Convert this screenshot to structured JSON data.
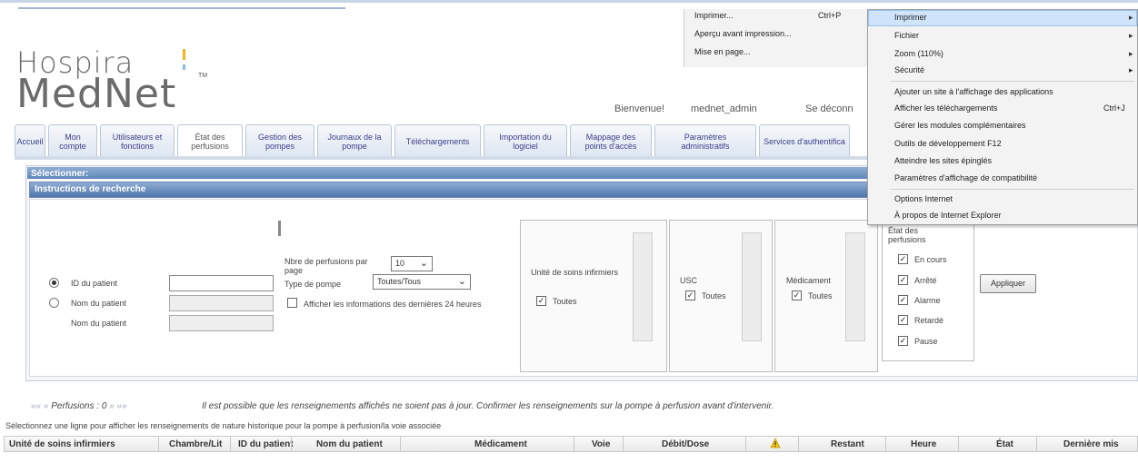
{
  "logo": {
    "line1": "Hospira",
    "line2": "MedNet",
    "tm": "TM"
  },
  "header": {
    "welcome": "Bienvenue!",
    "username": "mednet_admin",
    "logout": "Se déconn"
  },
  "nav": {
    "tabs": [
      {
        "label": "Accueil"
      },
      {
        "label": "Mon compte"
      },
      {
        "label": "Utilisateurs et fonctions"
      },
      {
        "label": "État des perfusions"
      },
      {
        "label": "Gestion des pompes"
      },
      {
        "label": "Journaux de la pompe"
      },
      {
        "label": "Téléchargements"
      },
      {
        "label": "Importation du logiciel"
      },
      {
        "label": "Mappage des points d'accès"
      },
      {
        "label": "Paramètres administratifs"
      },
      {
        "label": "Services d'authentifica"
      }
    ]
  },
  "search": {
    "select_label": "Sélectionner:",
    "instructions_label": "Instructions de recherche",
    "patient_id_label": "ID du patient",
    "patient_name_label": "Nom du patient",
    "patient_name_label2": "Nom du patient",
    "per_page_label": "Nbre de perfusions par page",
    "per_page_value": "10",
    "pump_type_label": "Type de pompe",
    "pump_type_value": "Toutes/Tous",
    "last24_label": "Afficher les informations des dernières 24 heures",
    "care_unit_label": "Unité de soins infirmiers",
    "care_unit_all": "Toutes",
    "usc_label": "USC",
    "usc_all": "Toutes",
    "medication_label": "Médicament",
    "medication_all": "Toutes",
    "status_label": "État des perfusions",
    "status_options": [
      "En cours",
      "Arrêté",
      "Alarme",
      "Retardé",
      "Pause"
    ],
    "apply_label": "Appliquer"
  },
  "pager": {
    "first": "«« ",
    "prev": "« ",
    "label": "Perfusions : 0",
    "next": " »",
    "last": " »»"
  },
  "warning": "Il est possible que les renseignements affichés ne soient pas à jour. Confirmer les renseignements sur la pompe à perfusion avant d'intervenir.",
  "hint": "Sélectionnez une ligne pour afficher les renseignements de nature historique pour la pompe à perfusion/la voie associée",
  "table": {
    "headers": [
      "Unité de soins infirmiers",
      "Chambre/Lit",
      "ID du patient",
      "Nom du patient",
      "Médicament",
      "Voie",
      "Débit/Dose",
      "",
      "Restant",
      "Heure",
      "État",
      "Dernière mis"
    ]
  },
  "ctx_left": {
    "items": [
      "Imprimer...",
      "Aperçu avant impression...",
      "Mise en page..."
    ],
    "shortcut": "Ctrl+P"
  },
  "ctx_right": {
    "items": [
      {
        "label": "Imprimer",
        "arrow": "▸"
      },
      {
        "label": "Fichier",
        "arrow": "▸"
      },
      {
        "label": "Zoom (110%)",
        "arrow": "▸"
      },
      {
        "label": "Sécurité",
        "arrow": "▸"
      },
      {
        "label": "Ajouter un site à l'affichage des applications"
      },
      {
        "label": "Afficher les téléchargements",
        "shortcut": "Ctrl+J"
      },
      {
        "label": "Gérer les modules complémentaires"
      },
      {
        "label": "Outils de développement F12"
      },
      {
        "label": "Atteindre les sites épinglés"
      },
      {
        "label": "Paramètres d'affichage de compatibilité"
      },
      {
        "label": "Options Internet"
      },
      {
        "label": "À propos de Internet Explorer"
      }
    ]
  },
  "colors": {
    "nav_text": "#3b3f8a",
    "panel_header": "#5f86bb",
    "menu_highlight": "#cfe4fb"
  }
}
